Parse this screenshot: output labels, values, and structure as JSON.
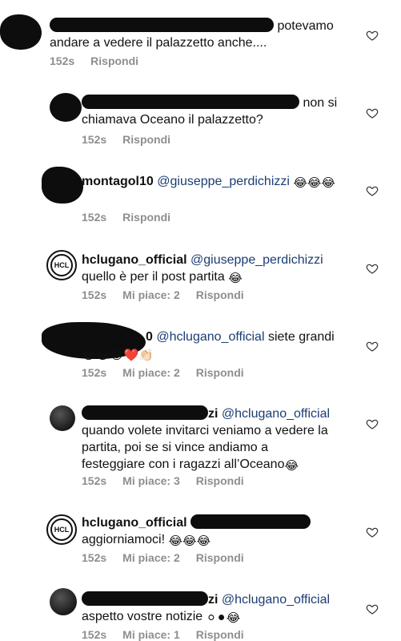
{
  "comments": [
    {
      "username_visible": "",
      "text_after": "potevamo andare a vedere il palazzetto anche....",
      "text_line1": "potevamo",
      "text_line2": "andare a vedere il palazzetto anche....",
      "time": "152s",
      "reply": "Rispondi"
    },
    {
      "username_visible": "",
      "text_line1": "non si",
      "text_line2": "chiamava Oceano il palazzetto?",
      "time": "152s",
      "reply": "Rispondi"
    },
    {
      "username": "montagol10",
      "mention": "@giuseppe_perdichizzi",
      "emojis": "😂😂😂",
      "time": "152s",
      "reply": "Rispondi"
    },
    {
      "username": "hclugano_official",
      "mention": "@giuseppe_perdichizzi",
      "text_line2": "quello è per il post partita",
      "emojis": "😂",
      "time": "152s",
      "likes": "Mi piace: 2",
      "reply": "Rispondi"
    },
    {
      "username_tail": "0",
      "mention": "@hclugano_official",
      "text": "siete grandi",
      "emojis": "😂😂😂❤️👏🏻",
      "time": "152s",
      "likes": "Mi piace: 2",
      "reply": "Rispondi"
    },
    {
      "username_tail": "zi",
      "mention": "@hclugano_official",
      "text_line2": "quando volete invitarci veniamo a vedere la",
      "text_line3": "partita, poi se si vince andiamo a",
      "text_line4": "festeggiare con i ragazzi all’Oceano",
      "emojis": "😂",
      "time": "152s",
      "likes": "Mi piace: 3",
      "reply": "Rispondi"
    },
    {
      "username": "hclugano_official",
      "text_line2": "aggiorniamoci!",
      "emojis": "😂😂😂",
      "time": "152s",
      "likes": "Mi piace: 2",
      "reply": "Rispondi"
    },
    {
      "username_tail": "zi",
      "mention": "@hclugano_official",
      "text_line2": "aspetto vostre notizie",
      "emojis": "⚪⚫😂",
      "time": "152s",
      "likes": "Mi piace: 1",
      "reply": "Rispondi"
    }
  ],
  "logo_text": "HCL",
  "colors": {
    "mention": "#1b3d73",
    "meta": "#8e8e8e",
    "redaction": "#0d0d0d"
  },
  "icons": {
    "like": "heart-outline-icon"
  }
}
